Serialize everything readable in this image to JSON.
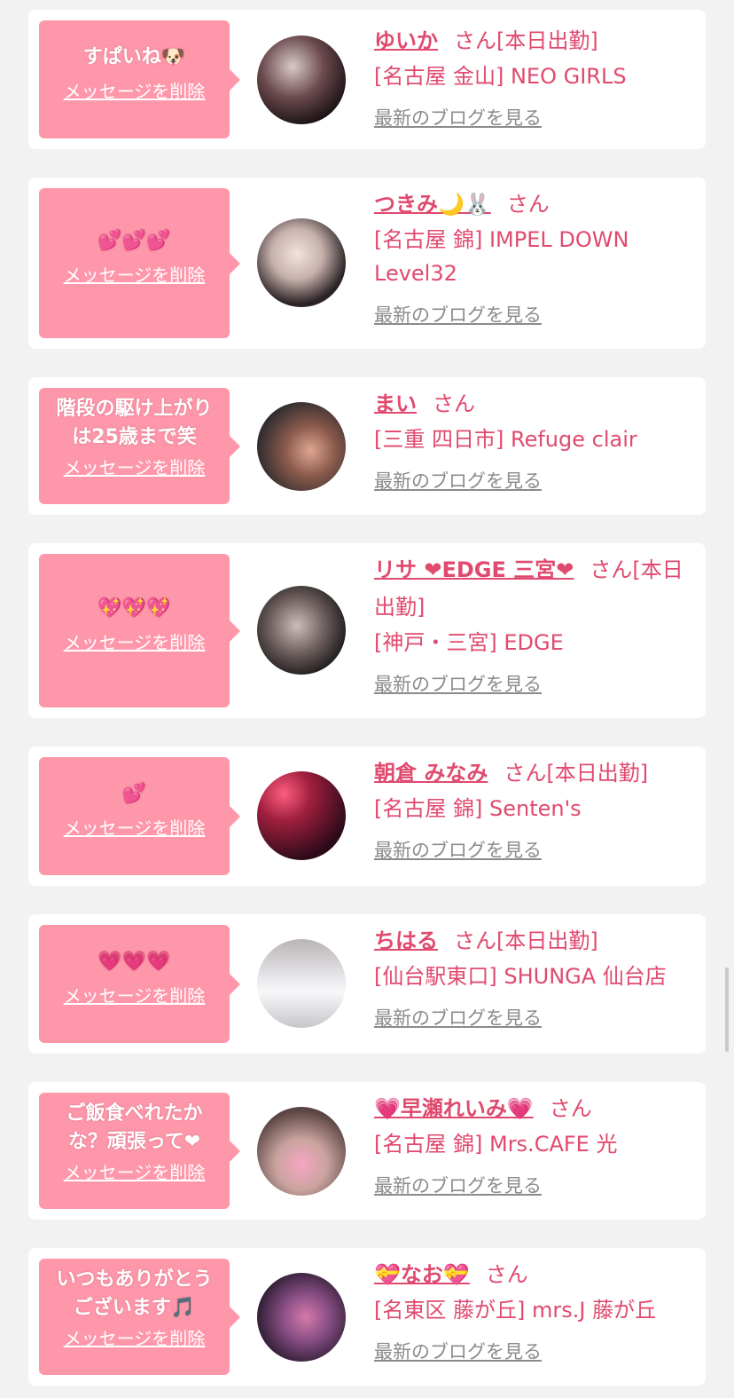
{
  "common": {
    "delete_label": "メッセージを削除",
    "blog_label": "最新のブログを見る",
    "honorific": "さん"
  },
  "colors": {
    "page_bg": "#f2f2f2",
    "bubble_bg": "#ff97ab",
    "name_text": "#e04a6e",
    "link_gray": "#8b8b8b"
  },
  "cards": [
    {
      "message": "すぱいね🐶",
      "name": "ゆいか",
      "status": "[本日出勤]",
      "shop": "[名古屋 金山] NEO GIRLS",
      "avatar_icon": "avatar-photo"
    },
    {
      "message": "💕💕💕",
      "name": "つきみ🌙🐰",
      "status": "",
      "shop": "[名古屋 錦] IMPEL DOWN Level32",
      "avatar_icon": "avatar-photo"
    },
    {
      "message": "階段の駆け上がりは25歳まで笑",
      "name": "まい",
      "status": "",
      "shop": "[三重 四日市] Refuge clair",
      "avatar_icon": "avatar-photo"
    },
    {
      "message": "💖💖💖",
      "name": "リサ ❤EDGE 三宮❤",
      "status": "[本日出勤]",
      "shop": "[神戸・三宮] EDGE",
      "avatar_icon": "avatar-photo"
    },
    {
      "message": "💕",
      "name": "朝倉 みなみ",
      "status": "[本日出勤]",
      "shop": "[名古屋 錦] Senten's",
      "avatar_icon": "avatar-photo"
    },
    {
      "message": "💗💗💗",
      "name": "ちはる",
      "status": "[本日出勤]",
      "shop": "[仙台駅東口] SHUNGA 仙台店",
      "avatar_icon": "avatar-photo"
    },
    {
      "message": "ご飯食べれたかな？頑張って❤",
      "name": "💗早瀬れいみ💗",
      "status": "",
      "shop": "[名古屋 錦] Mrs.CAFE 光",
      "avatar_icon": "avatar-photo"
    },
    {
      "message": "いつもありがとうございます🎵",
      "name": "💝なお💝",
      "status": "",
      "shop": "[名東区 藤が丘] mrs.J 藤が丘",
      "avatar_icon": "avatar-photo"
    }
  ]
}
